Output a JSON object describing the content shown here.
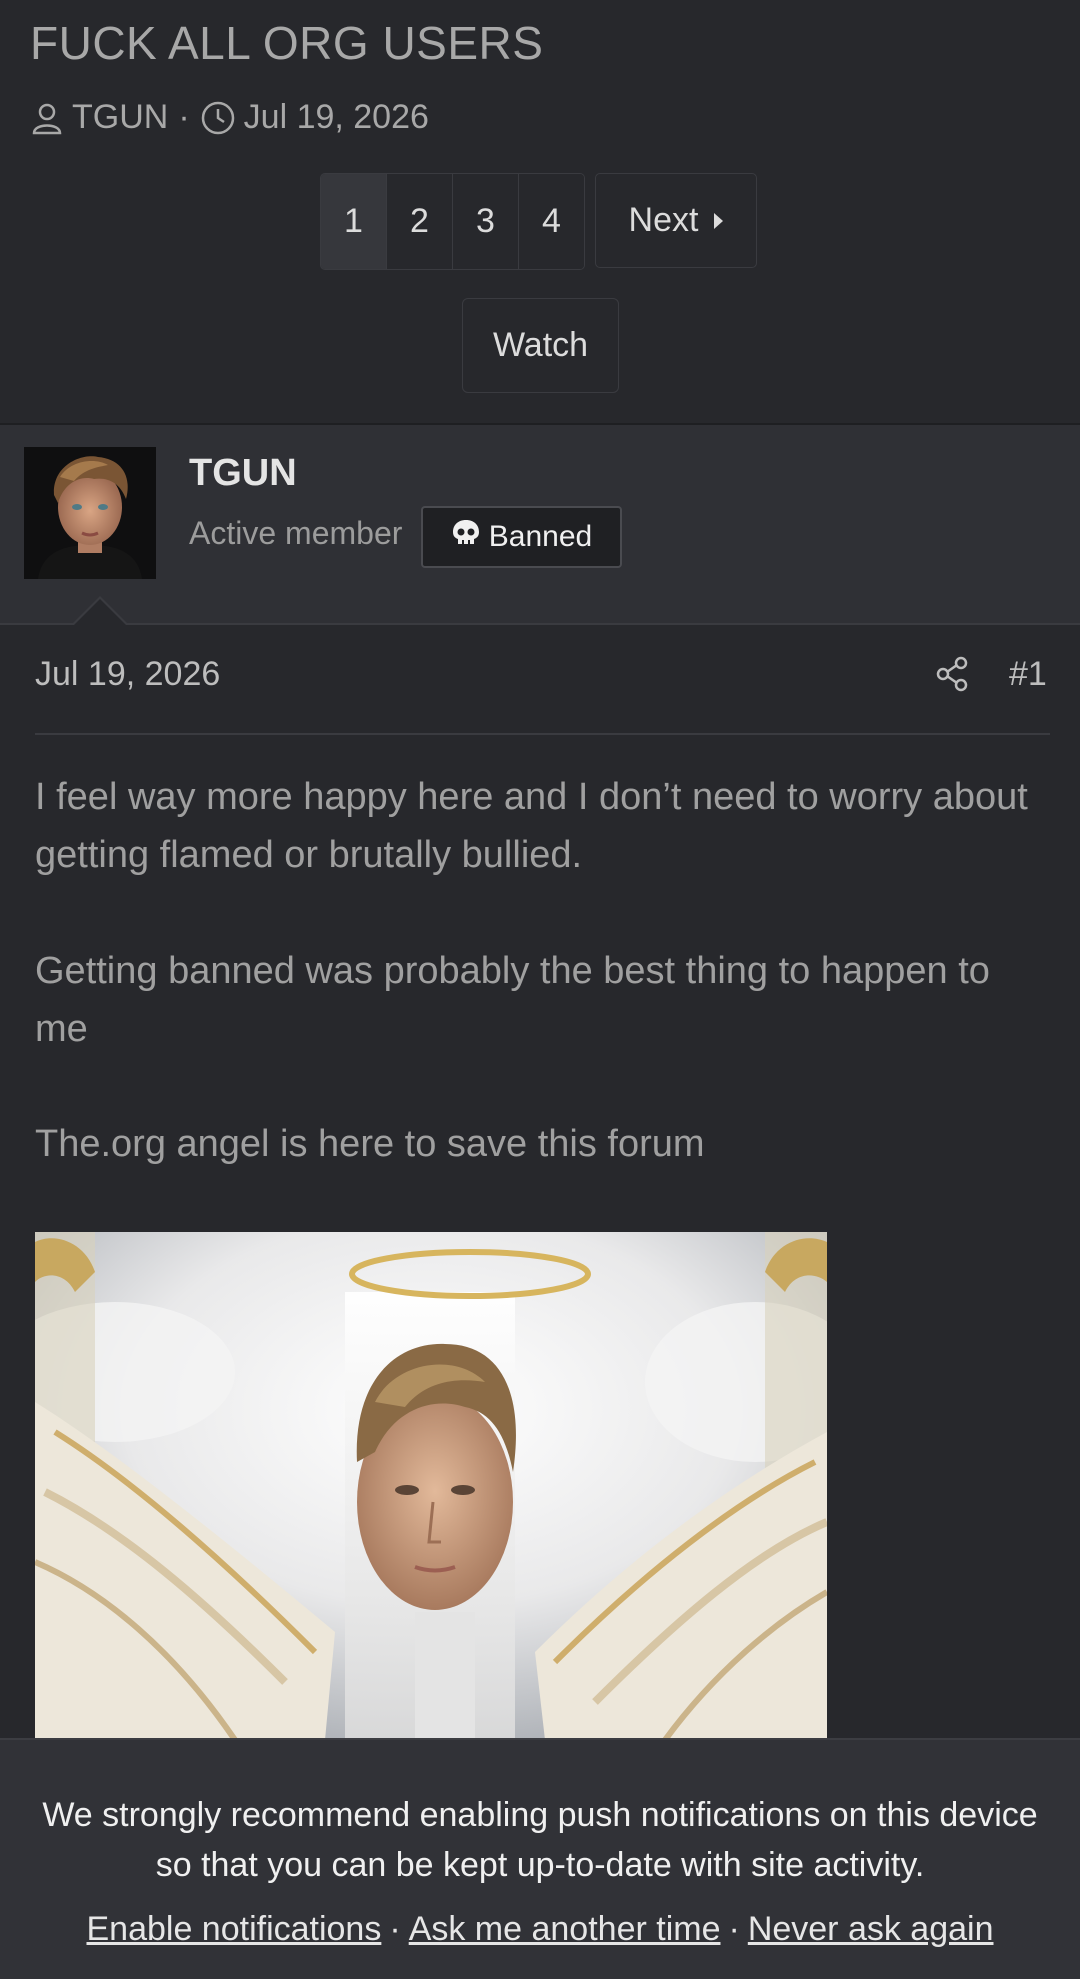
{
  "thread": {
    "title": "FUCK ALL ORG USERS",
    "author": "TGUN",
    "date": "Jul 19, 2026"
  },
  "pagination": {
    "pages": [
      "1",
      "2",
      "3",
      "4"
    ],
    "current": "1",
    "next_label": "Next"
  },
  "watch_label": "Watch",
  "post": {
    "username": "TGUN",
    "user_title": "Active member",
    "badge": "Banned",
    "date": "Jul 19, 2026",
    "number": "#1",
    "paragraphs": [
      "I feel way more happy here and I don’t need to worry about getting flamed or brutally bullied.",
      "Getting banned was probably the best thing to happen to me",
      "The.org angel is here to save this forum"
    ]
  },
  "push_notice": {
    "message": "We strongly recommend enabling push notifications on this device so that you can be kept up-to-date with site activity.",
    "enable": "Enable notifications",
    "later": "Ask me another time",
    "never": "Never ask again"
  },
  "colors": {
    "background": "#27282c",
    "userbar": "#2f3035",
    "badge_bg": "#1f2023"
  },
  "icons": [
    "user-icon",
    "clock-icon",
    "next-arrow-icon",
    "skull-icon",
    "share-icon"
  ]
}
